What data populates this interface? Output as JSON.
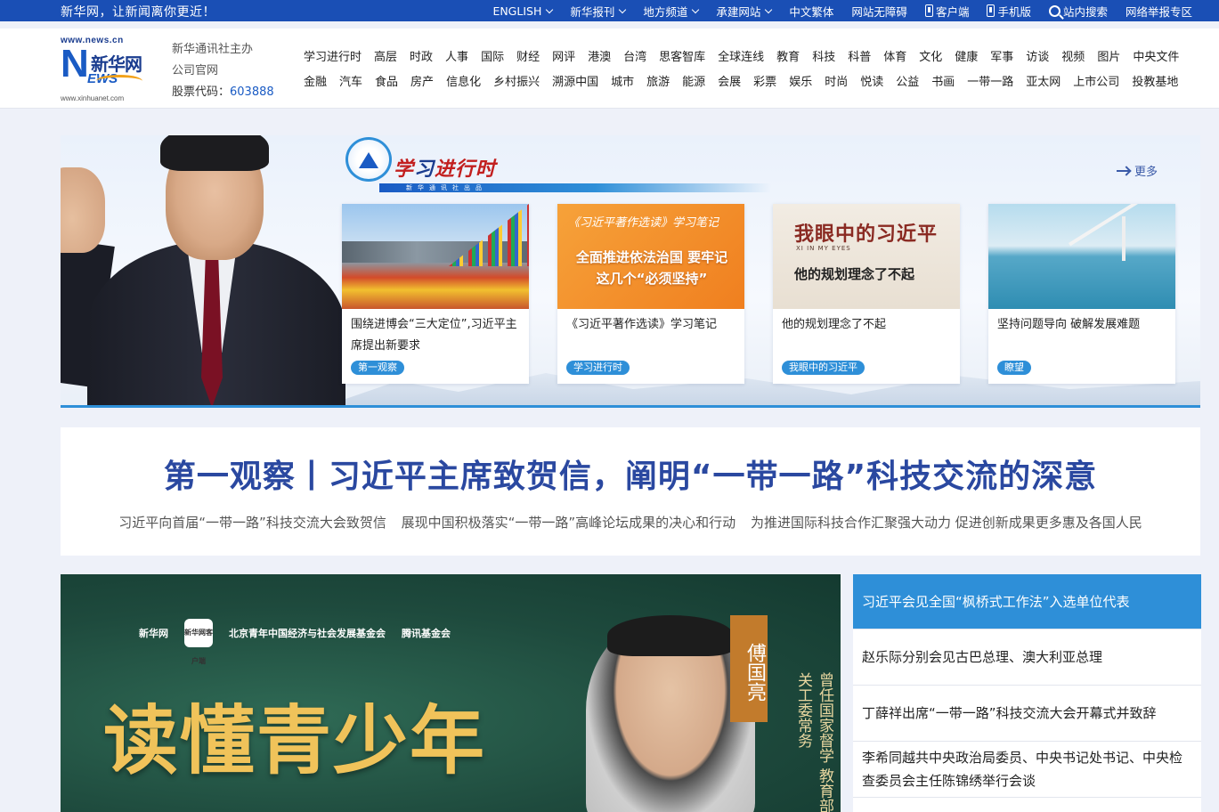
{
  "topbar": {
    "slogan": "新华网，让新闻离你更近！",
    "items": [
      {
        "label": "ENGLISH",
        "dropdown": true
      },
      {
        "label": "新华报刊",
        "dropdown": true
      },
      {
        "label": "地方频道",
        "dropdown": true
      },
      {
        "label": "承建网站",
        "dropdown": true
      },
      {
        "label": "中文繁体",
        "dropdown": false
      },
      {
        "label": "网站无障碍",
        "dropdown": false
      },
      {
        "label": "客户端",
        "icon": "phone-icon"
      },
      {
        "label": "手机版",
        "icon": "mobile-icon"
      },
      {
        "label": "站内搜索",
        "icon": "search-icon"
      },
      {
        "label": "网络举报专区",
        "dropdown": false
      }
    ]
  },
  "logo": {
    "url_top": "www.news.cn",
    "letter": "N",
    "name_cn": "新华网",
    "letters": "EWS",
    "url_bottom": "www.xinhuanet.com"
  },
  "sponsor": {
    "line1": "新华通讯社主办",
    "line2": "公司官网",
    "stock_label": "股票代码：",
    "stock_code": "603888"
  },
  "nav": {
    "row1": [
      "学习进行时",
      "高层",
      "时政",
      "人事",
      "国际",
      "财经",
      "网评",
      "港澳",
      "台湾",
      "思客智库",
      "全球连线",
      "教育",
      "科技",
      "科普",
      "体育",
      "文化",
      "健康",
      "军事",
      "访谈",
      "视频",
      "图片",
      "中央文件"
    ],
    "row2": [
      "金融",
      "汽车",
      "食品",
      "房产",
      "信息化",
      "乡村振兴",
      "溯源中国",
      "城市",
      "旅游",
      "能源",
      "会展",
      "彩票",
      "娱乐",
      "时尚",
      "悦读",
      "公益",
      "书画",
      "一带一路",
      "亚太网",
      "上市公司",
      "投教基地"
    ]
  },
  "banner": {
    "title_a": "学",
    "title_b": "习",
    "title_c": "进行时",
    "subtitle": "新华通讯社出品",
    "more": "更多",
    "cards": [
      {
        "title": "围绕进博会“三大定位”,习近平主席提出新要求",
        "tag": "第一观察"
      },
      {
        "title": "《习近平著作选读》学习笔记",
        "tag": "学习进行时",
        "img_line1": "《习近平著作选读》学习笔记",
        "img_line2": "全面推进依法治国 要牢记这几个“必须坚持”"
      },
      {
        "title": "他的规划理念了不起",
        "tag": "我眼中的习近平",
        "img_line1": "我眼中的习近平",
        "img_line0": "XI IN MY EYES",
        "img_line2": "他的规划理念了不起"
      },
      {
        "title": "坚持问题导向 破解发展难题",
        "tag": "瞭望"
      }
    ]
  },
  "headline": {
    "title": "第一观察丨习近平主席致贺信，阐明“一带一路”科技交流的深意",
    "links": [
      "习近平向首届“一带一路”科技交流大会致贺信",
      "展现中国积极落实“一带一路”高峰论坛成果的决心和行动",
      "为推进国际科技合作汇聚强大动力 促进创新成果更多惠及各国人民"
    ]
  },
  "video": {
    "logo1": "新华网",
    "logo2": "新华网客户端",
    "logo3": "北京青年中国经济与社会发展基金会",
    "logo4": "腾讯基金会",
    "title": "读懂青少年",
    "name": "傅国亮",
    "desc": "曾任国家督学 教育部关工委常务"
  },
  "news": [
    "习近平会见全国“枫桥式工作法”入选单位代表",
    "赵乐际分别会见古巴总理、澳大利亚总理",
    "丁薛祥出席“一带一路”科技交流大会开幕式并致辞",
    "李希同越共中央政治局委员、中央书记处书记、中央检查委员会主任陈锦绣举行会谈"
  ],
  "colors": {
    "brand_blue": "#1a4fb5",
    "accent": "#2e8fd8",
    "headline": "#2a48a0"
  }
}
